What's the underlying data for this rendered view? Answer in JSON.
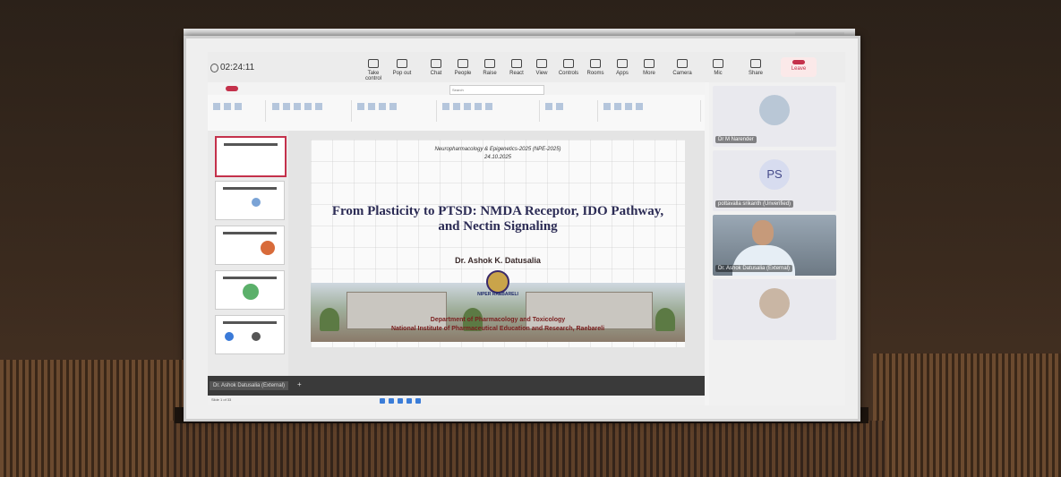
{
  "teams_meeting": {
    "timer": "02:24:11",
    "toolbar": [
      {
        "label": "Take control",
        "icon": "take-control-icon"
      },
      {
        "label": "Pop out",
        "icon": "pop-out-icon"
      },
      {
        "label": "Chat",
        "icon": "chat-icon"
      },
      {
        "label": "People",
        "icon": "people-icon"
      },
      {
        "label": "Raise",
        "icon": "raise-hand-icon"
      },
      {
        "label": "React",
        "icon": "react-icon"
      },
      {
        "label": "View",
        "icon": "view-icon"
      },
      {
        "label": "Controls",
        "icon": "controls-icon"
      },
      {
        "label": "Rooms",
        "icon": "rooms-icon"
      },
      {
        "label": "Apps",
        "icon": "apps-icon"
      },
      {
        "label": "More",
        "icon": "more-icon"
      },
      {
        "label": "Camera",
        "icon": "camera-icon"
      },
      {
        "label": "Mic",
        "icon": "mic-icon"
      },
      {
        "label": "Share",
        "icon": "share-icon"
      }
    ],
    "leave_label": "Leave",
    "participants": [
      {
        "name": "Dr M Narender",
        "type": "photo"
      },
      {
        "name": "pottavalla srikanth (Unverified)",
        "initials": "PS",
        "type": "initials"
      },
      {
        "name": "Dr. Ashok Datusalia (External)",
        "type": "video"
      },
      {
        "name": "",
        "type": "photo"
      }
    ],
    "shared_window_label": "Dr. Ashok Datusalia (External)"
  },
  "slide": {
    "conference": "Neuropharmacology & Epigenetics-2025 (NPE-2025)",
    "date": "24.10.2025",
    "title": "From Plasticity to PTSD: NMDA Receptor, IDO Pathway, and Nectin Signaling",
    "author": "Dr. Ashok K. Datusalia",
    "logo_text": "NIPER RAEBARELI",
    "department": "Department of Pharmacology and Toxicology",
    "institute": "National Institute of Pharmaceutical Education and Research, Raebareli"
  },
  "ppt": {
    "search_placeholder": "Search",
    "status_text": "Slide 1 of 33"
  },
  "colors": {
    "title_color": "#2c2c55",
    "institute_color": "#7a1e1e",
    "leave_color": "#c4314b"
  }
}
